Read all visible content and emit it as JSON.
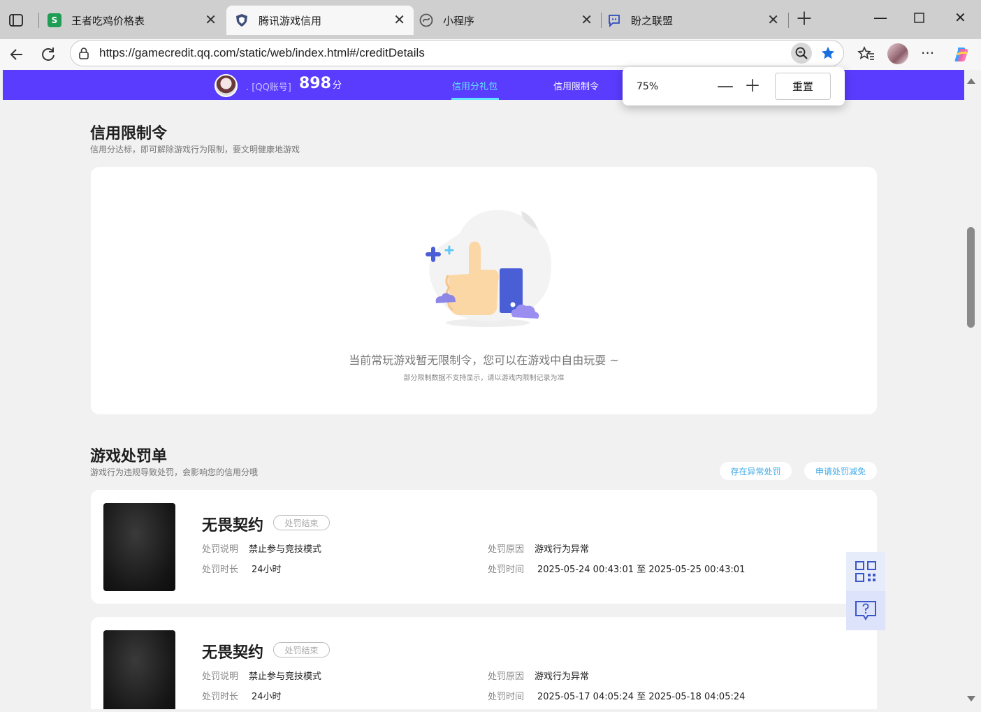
{
  "browser": {
    "tabs": [
      {
        "title": "王者吃鸡价格表",
        "icon": "sheets-icon"
      },
      {
        "title": "腾讯游戏信用",
        "icon": "shield-icon"
      },
      {
        "title": "小程序",
        "icon": "miniprogram-icon"
      },
      {
        "title": "盼之联盟",
        "icon": "chat-icon"
      }
    ],
    "url": "https://gamecredit.qq.com/static/web/index.html#/creditDetails",
    "zoom_popup": {
      "percent": "75%",
      "reset_label": "重置"
    }
  },
  "banner": {
    "account_label": ". [QQ账号]",
    "score": "898",
    "score_unit": "分",
    "nav": [
      "信用分礼包",
      "信用限制令"
    ]
  },
  "restriction": {
    "title": "信用限制令",
    "subtitle": "信用分达标，即可解除游戏行为限制，要文明健康地游戏",
    "empty_main": "当前常玩游戏暂无限制令，您可以在游戏中自由玩耍 ~",
    "empty_note": "部分限制数据不支持显示，请以游戏内限制记录为准"
  },
  "penalty": {
    "title": "游戏处罚单",
    "subtitle": "游戏行为违规导致处罚，会影响您的信用分哦",
    "btn_abnormal": "存在异常处罚",
    "btn_appeal": "申请处罚减免",
    "labels": {
      "desc": "处罚说明",
      "duration": "处罚时长",
      "reason": "处罚原因",
      "time": "处罚时间"
    },
    "items": [
      {
        "game": "无畏契约",
        "status": "处罚结束",
        "desc": "禁止参与竞技模式",
        "duration": "24小时",
        "reason": "游戏行为异常",
        "time": "2025-05-24 00:43:01 至 2025-05-25 00:43:01"
      },
      {
        "game": "无畏契约",
        "status": "处罚结束",
        "desc": "禁止参与竞技模式",
        "duration": "24小时",
        "reason": "游戏行为异常",
        "time": "2025-05-17 04:05:24 至 2025-05-18 04:05:24"
      }
    ]
  },
  "colors": {
    "banner": "#5a3cff",
    "nav_active": "#60e3ff",
    "pill_text": "#3fa9e8"
  }
}
